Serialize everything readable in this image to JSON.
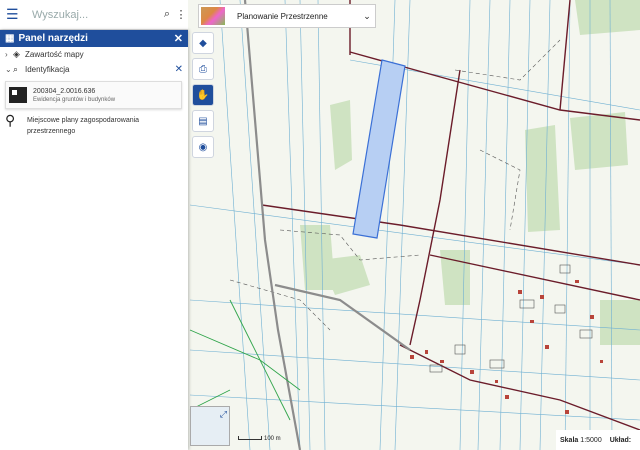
{
  "search": {
    "placeholder": "Wyszukaj..."
  },
  "panel": {
    "title": "Panel narzędzi",
    "rows": [
      {
        "label": "Zawartość mapy"
      },
      {
        "label": "Identyfikacja"
      }
    ],
    "result": {
      "id": "200304_2.0016.636",
      "layer": "Ewidencja gruntów i budynków"
    },
    "mpzp": {
      "line1": "Miejscowe plany zagospodarowania",
      "line2": "przestrzennego"
    }
  },
  "layer": {
    "name": "Planowanie Przestrzenne"
  },
  "scalebar": {
    "label": "100 m"
  },
  "status": {
    "scale_label": "Skala",
    "scale_value": "1:5000",
    "uklad_label": "Układ:"
  },
  "colors": {
    "primary": "#1f4e9c",
    "parcel_fill": "#b7cff3",
    "parcel_stroke": "#3b70d6"
  },
  "icons": [
    "menu-icon",
    "search-icon",
    "more-icon",
    "grid-icon",
    "close-icon",
    "layers-icon",
    "search-small-icon",
    "building-icon",
    "pin-icon",
    "print-icon",
    "hand-icon",
    "clipboard-icon",
    "camera-icon",
    "expand-icon",
    "chevron-down-icon"
  ]
}
